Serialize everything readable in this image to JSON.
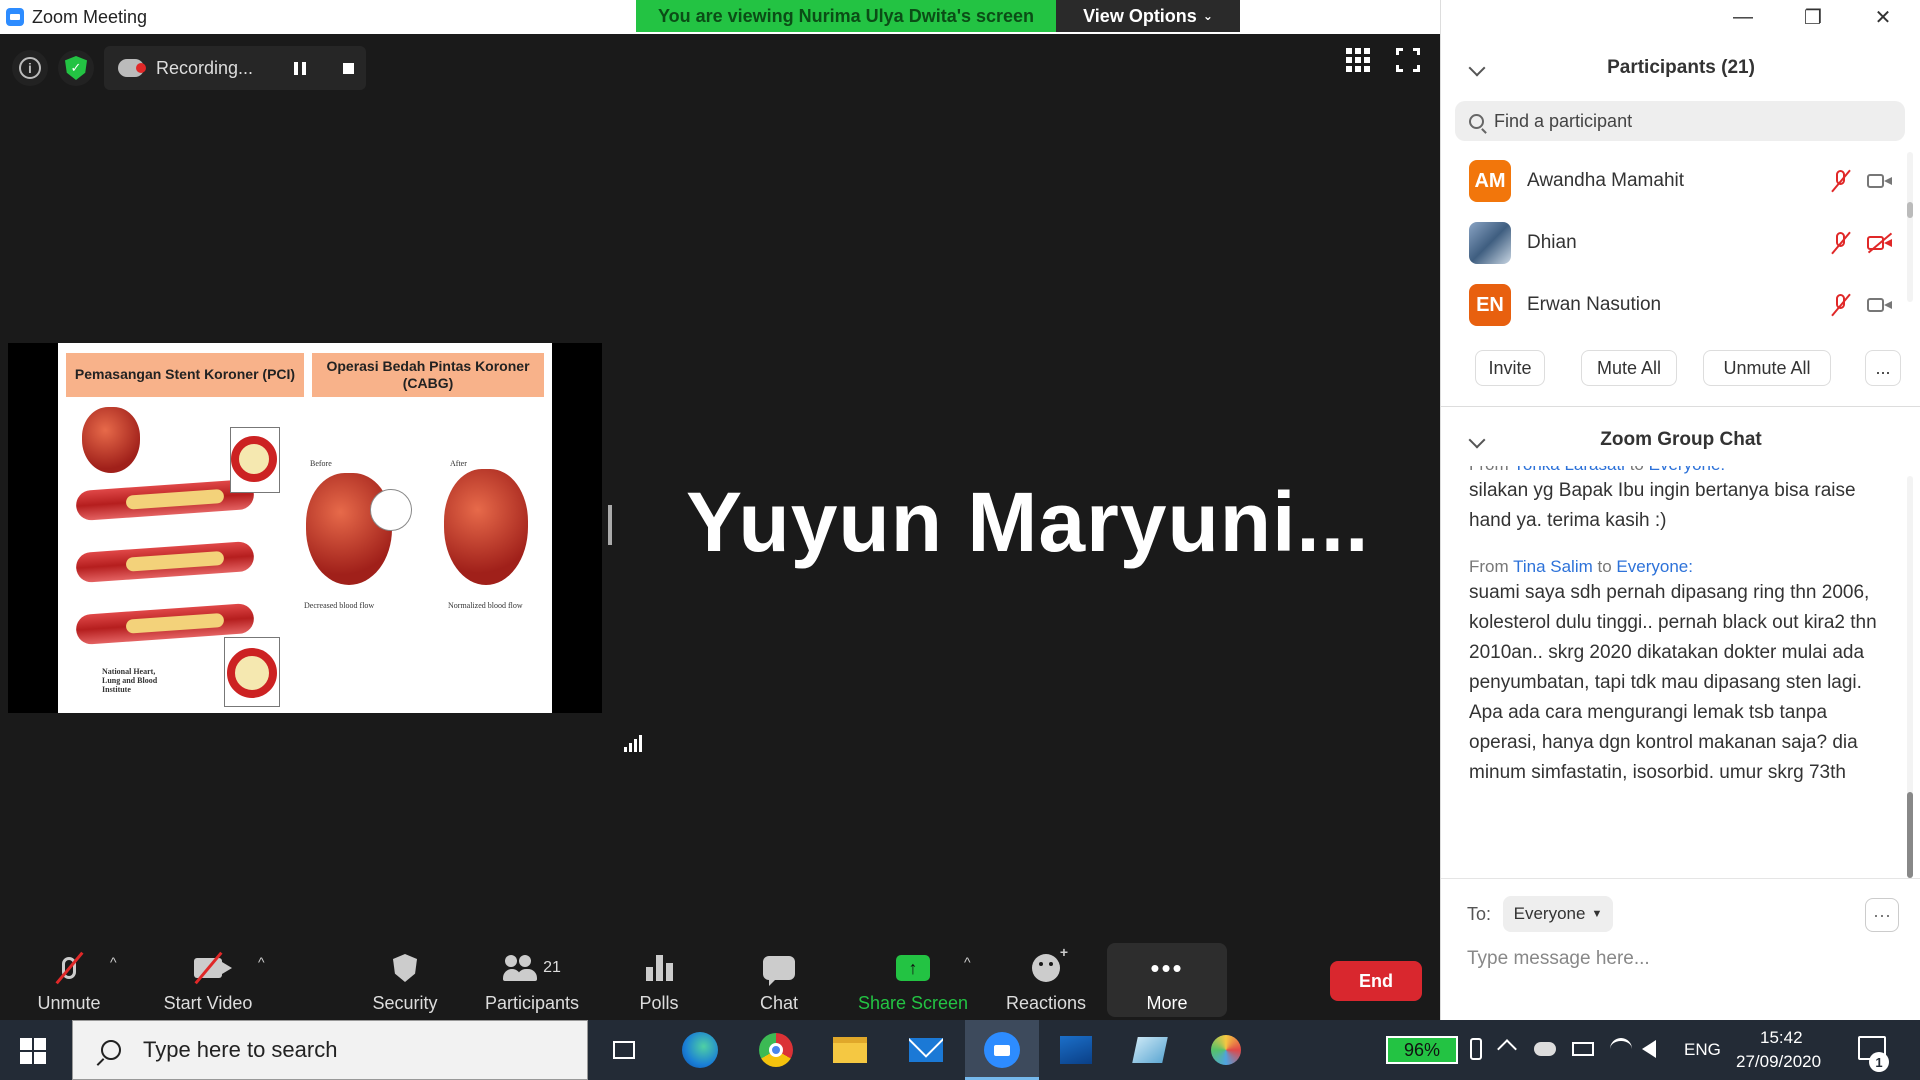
{
  "window": {
    "title": "Zoom Meeting",
    "banner": "You are viewing Nurima Ulya Dwita's screen",
    "view_options": "View Options",
    "minimize": "—",
    "restore": "❐",
    "close": "✕"
  },
  "meeting": {
    "recording_label": "Recording...",
    "speaker_name": "Yuyun  Maryuni...",
    "slide": {
      "title_left": "Pemasangan Stent Koroner (PCI)",
      "title_right": "Operasi Bedah Pintas Koroner (CABG)",
      "label_before": "Before",
      "label_after": "After",
      "label_decreased": "Decreased blood flow",
      "label_normalized": "Normalized blood flow",
      "label_nhlbi": "National Heart, Lung and Blood Institute"
    }
  },
  "toolbar": {
    "unmute": "Unmute",
    "start_video": "Start Video",
    "security": "Security",
    "participants": "Participants",
    "participants_count": "21",
    "polls": "Polls",
    "chat": "Chat",
    "share_screen": "Share Screen",
    "reactions": "Reactions",
    "more": "More",
    "end": "End"
  },
  "participants_panel": {
    "title": "Participants (21)",
    "search_placeholder": "Find a participant",
    "participants": [
      {
        "initials": "AM",
        "name": "Awandha Mamahit",
        "avatar_color": "#f2760b",
        "video_off": false
      },
      {
        "initials": "",
        "name": "Dhian",
        "avatar_color": "#6b8bb0",
        "video_off": true
      },
      {
        "initials": "EN",
        "name": "Erwan Nasution",
        "avatar_color": "#e8600f",
        "video_off": false
      }
    ],
    "invite": "Invite",
    "mute_all": "Mute All",
    "unmute_all": "Unmute All",
    "more": "..."
  },
  "chat_panel": {
    "title": "Zoom Group Chat",
    "messages": [
      {
        "from_prefix": "From",
        "sender": "Yohka Larasati",
        "to_word": "to",
        "recipient": "Everyone:",
        "text": "silakan yg Bapak Ibu ingin bertanya bisa raise hand ya. terima kasih :)"
      },
      {
        "from_prefix": "From",
        "sender": "Tina Salim",
        "to_word": "to",
        "recipient": "Everyone:",
        "text": "suami saya sdh pernah dipasang ring thn 2006, kolesterol dulu tinggi.. pernah black out kira2 thn 2010an.. skrg 2020 dikatakan dokter mulai ada penyumbatan, tapi tdk mau dipasang sten lagi. Apa ada cara mengurangi lemak tsb tanpa operasi, hanya dgn kontrol makanan saja? dia minum simfastatin, isosorbid. umur skrg 73th"
      }
    ],
    "to_label": "To:",
    "to_value": "Everyone",
    "more": "···",
    "input_placeholder": "Type message here..."
  },
  "taskbar": {
    "search_placeholder": "Type here to search",
    "battery": "96%",
    "language": "ENG",
    "time": "15:42",
    "date": "27/09/2020",
    "notification_count": "1"
  }
}
